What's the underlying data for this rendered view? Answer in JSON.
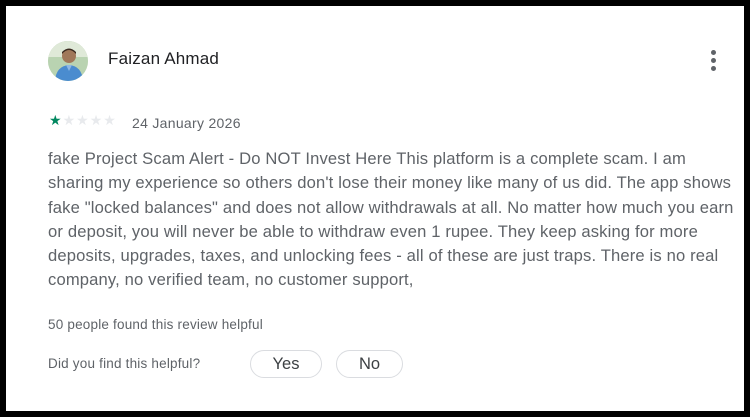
{
  "review": {
    "author": "Faizan Ahmad",
    "rating": 1,
    "rating_max": 5,
    "date": "24 January 2026",
    "text": "fake Project Scam Alert - Do NOT Invest Here This platform is a complete scam. I am sharing my experience so others don't lose their money like many of us did. The app shows fake \"locked balances\" and does not allow withdrawals at all. No matter how much you earn or deposit, you will never be able to withdraw even 1 rupee. They keep asking for more deposits, upgrades, taxes, and unlocking fees - all of these are just traps. There is no real company, no verified team, no customer support,",
    "helpful_count_text": "50 people found this review helpful"
  },
  "feedback": {
    "question": "Did you find this helpful?",
    "yes_label": "Yes",
    "no_label": "No"
  },
  "icons": {
    "menu": "more-vert-icon",
    "star": "star-icon",
    "avatar": "user-avatar"
  },
  "colors": {
    "star_filled": "#01875f",
    "star_empty": "#e8eaed",
    "text_primary": "#202124",
    "text_secondary": "#5f6368",
    "border": "#dadce0",
    "frame": "#000000"
  }
}
